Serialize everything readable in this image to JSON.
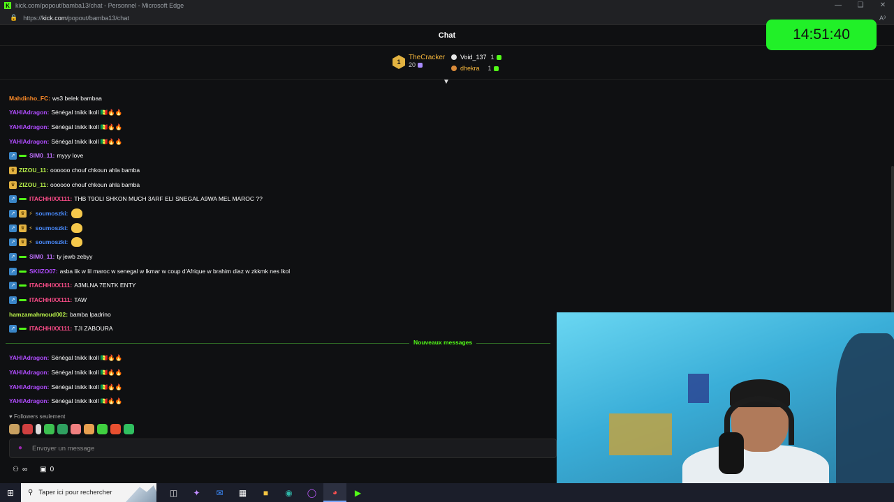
{
  "window": {
    "title": "kick.com/popout/bamba13/chat - Personnel - Microsoft Edge",
    "url_prefix": "https://",
    "url_host": "kick.com",
    "url_path": "/popout/bamba13/chat",
    "reader_icon": "A³"
  },
  "header": {
    "title": "Chat"
  },
  "clock": {
    "time": "14:51:40"
  },
  "leaderboard": {
    "first": {
      "rank": "1",
      "name": "TheCracker",
      "count": "20"
    },
    "second": {
      "name": "Void_137",
      "count": "1"
    },
    "third": {
      "name": "dhekra",
      "count": "1"
    }
  },
  "colors": {
    "kick_green": "#53fc18",
    "clock_green": "#21f028",
    "gold": "#f6b73c",
    "purple_user": "#b04cff",
    "orange_user": "#ff8c28",
    "lime_user": "#b8f04a",
    "pink_user": "#ff4d8a",
    "blue_user": "#4a8cff",
    "sim_user": "#c070ff"
  },
  "messages": [
    {
      "user": "Mahdinho_FC",
      "text": "ws3 belek bambaa"
    },
    {
      "user": "YAHIAdragon",
      "text": "Sénégal tnikk lkoll 🇸🇳🔥🔥"
    },
    {
      "user": "YAHIAdragon",
      "text": "Sénégal tnikk lkoll 🇸🇳🔥🔥"
    },
    {
      "user": "YAHIAdragon",
      "text": "Sénégal tnikk lkoll 🇸🇳🔥🔥"
    },
    {
      "user": "SIM0_11",
      "text": "myyy love"
    },
    {
      "user": "ZIZOU_11",
      "text": "oooooo chouf chkoun ahla bamba"
    },
    {
      "user": "ZIZOU_11",
      "text": "oooooo chouf chkoun ahla bamba"
    },
    {
      "user": "ITACHHIXX111",
      "text": "THB T9OLI SHKON MUCH 3ARF ELI SNEGAL A9WA MEL MAROC ??"
    },
    {
      "user": "soumoszki",
      "text": ""
    },
    {
      "user": "soumoszki",
      "text": ""
    },
    {
      "user": "soumoszki",
      "text": ""
    },
    {
      "user": "SIM0_11",
      "text": "ty jewb zebyy"
    },
    {
      "user": "SKIIZO07",
      "text": "asba lik w lil maroc w senegal w lkmar w coup d'Afrique w brahim diaz w zkkmk nes lkol"
    },
    {
      "user": "ITACHHIXX111",
      "text": "A3MLNA 7ENTK ENTY"
    },
    {
      "user": "ITACHHIXX111",
      "text": "TAW"
    },
    {
      "user": "hamzamahmoud002",
      "text": "bamba lpadrino"
    },
    {
      "user": "ITACHHIXX111",
      "text": "TJI ZABOURA"
    }
  ],
  "new_messages_label": "Nouveaux messages",
  "new_messages": [
    {
      "user": "YAHIAdragon",
      "text": "Sénégal tnikk lkoll 🇸🇳🔥🔥"
    },
    {
      "user": "YAHIAdragon",
      "text": "Sénégal tnikk lkoll 🇸🇳🔥🔥"
    },
    {
      "user": "YAHIAdragon",
      "text": "Sénégal tnikk lkoll 🇸🇳🔥🔥"
    },
    {
      "user": "YAHIAdragon",
      "text": "Sénégal tnikk lkoll 🇸🇳🔥🔥"
    }
  ],
  "footer": {
    "followers_only": "Followers seulement",
    "input_placeholder": "Envoyer un message",
    "slowmode_value": "∞",
    "gift_count": "0"
  },
  "taskbar": {
    "search_placeholder": "Taper ici pour rechercher"
  }
}
